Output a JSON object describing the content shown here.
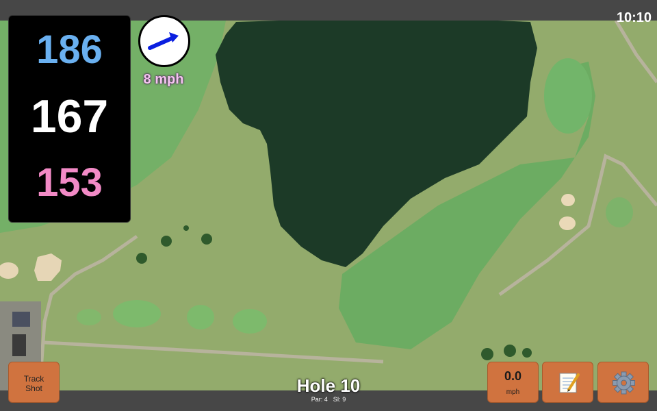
{
  "status": {
    "time": "10:10"
  },
  "distances": {
    "back": "186",
    "center": "167",
    "front": "153"
  },
  "wind": {
    "speed": "8 mph",
    "icon": "arrow-icon",
    "arrow_color": "#0a1fe0"
  },
  "hole": {
    "title": "Hole 10",
    "par": "Par: 4",
    "si": "SI: 9"
  },
  "buttons": {
    "track_shot": [
      "Track",
      "Shot"
    ],
    "speed_value": "0.0",
    "speed_unit": "mph",
    "notes_icon": "notepad-icon",
    "settings_icon": "gear-icon"
  },
  "colors": {
    "back": "#6ab0f0",
    "center": "#ffffff",
    "front": "#f28ac6",
    "button": "#d0733f",
    "water": "#1c3a27",
    "fairway": "#6fa85c",
    "rough": "#94a867"
  }
}
